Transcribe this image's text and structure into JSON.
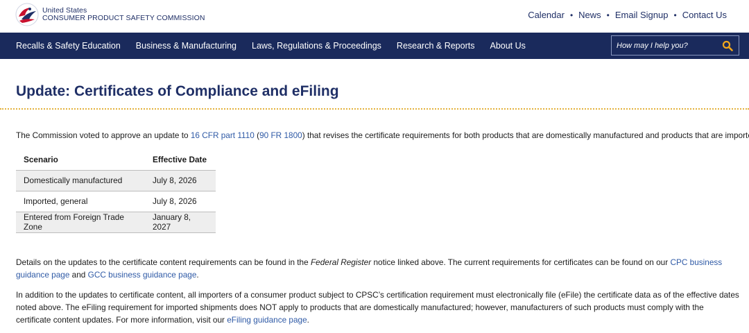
{
  "header": {
    "logo_line1": "United States",
    "logo_line2": "CONSUMER PRODUCT SAFETY COMMISSION",
    "utility_links": [
      "Calendar",
      "News",
      "Email Signup",
      "Contact Us"
    ]
  },
  "nav": {
    "items": [
      "Recalls & Safety Education",
      "Business & Manufacturing",
      "Laws, Regulations & Proceedings",
      "Research & Reports",
      "About Us"
    ],
    "search_placeholder": "How may I help you?"
  },
  "page": {
    "title": "Update: Certificates of Compliance and eFiling",
    "intro_before": "The Commission voted to approve an update to ",
    "intro_link1": "16 CFR part 1110",
    "intro_mid1": " (",
    "intro_link2": "90 FR 1800",
    "intro_after": ") that revises the certificate requirements for both products that are domestically manufactured and products that are imported:",
    "table": {
      "headers": [
        "Scenario",
        "Effective Date"
      ],
      "rows": [
        [
          "Domestically manufactured",
          "July 8, 2026"
        ],
        [
          "Imported, general",
          "July 8, 2026"
        ],
        [
          "Entered from Foreign Trade Zone",
          "January 8, 2027"
        ]
      ]
    },
    "p1_a": "Details on the updates to the certificate content requirements can be found in the ",
    "p1_italic": "Federal Register",
    "p1_b": " notice linked above. The current requirements for certificates can be found on our ",
    "p1_link1": "CPC business guidance page",
    "p1_c": " and ",
    "p1_link2": "GCC business guidance page",
    "p1_d": ".",
    "p2_a": "In addition to the updates to certificate content, all importers of a consumer product subject to CPSC’s certification requirement must electronically file (eFile) the certificate data as of the effective dates noted above. The eFiling requirement for imported shipments does NOT apply to products that are domestically manufactured; however, manufacturers of such products must comply with the certificate content updates. For more information, visit our ",
    "p2_link": "eFiling guidance page",
    "p2_b": "."
  },
  "colors": {
    "navy": "#1a2a5c",
    "title_blue": "#1f2f66",
    "link_blue": "#2f5aa6",
    "search_icon": "#f2a71b",
    "dotted_rule": "#e3b23c"
  },
  "icons": [
    "cpsc-eagle-logo",
    "search-icon"
  ]
}
